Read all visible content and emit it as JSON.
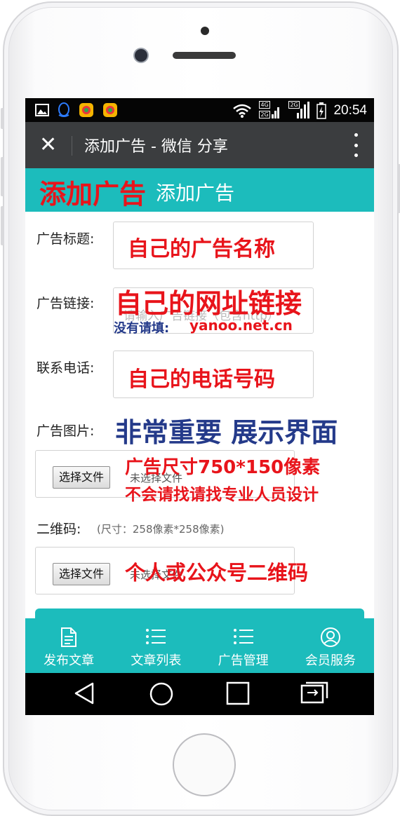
{
  "status_bar": {
    "time": "20:54",
    "network_badges": [
      "4G",
      "2G",
      "2G"
    ]
  },
  "titlebar": {
    "close_glyph": "✕",
    "title": "添加广告 - 微信 分享"
  },
  "banner": {
    "stamp_text": "添加广告",
    "title": "添加广告"
  },
  "form": {
    "ad_title": {
      "label": "广告标题:",
      "overlay": "自己的广告名称"
    },
    "ad_link": {
      "label": "广告链接:",
      "placeholder": "请输入广告链接（包含http）",
      "overlay": "自己的网址链接",
      "note_prefix": "没有请填:",
      "note_value": "yanoo.net.cn"
    },
    "phone": {
      "label": "联系电话:",
      "overlay": "自己的电话号码"
    },
    "ad_image": {
      "label": "广告图片:",
      "overlay_title": "非常重要 展示界面",
      "overlay_size": "广告尺寸750*150像素",
      "overlay_hint": "不会请找请找专业人员设计",
      "button": "选择文件",
      "no_file": "未选择文件"
    },
    "qrcode": {
      "label": "二维码:",
      "size_note": "(尺寸：258像素*258像素)",
      "overlay": "个人或公众号二维码",
      "button": "选择文件",
      "no_file": "未选择文件"
    }
  },
  "bottom_nav": [
    {
      "label": "发布文章",
      "icon": "document-icon"
    },
    {
      "label": "文章列表",
      "icon": "list-icon"
    },
    {
      "label": "广告管理",
      "icon": "list-icon"
    },
    {
      "label": "会员服务",
      "icon": "user-icon"
    }
  ],
  "colors": {
    "accent": "#1cbcbc",
    "overlay_red": "#e8141b",
    "overlay_blue": "#243a8a",
    "titlebar": "#3b3d3f"
  }
}
